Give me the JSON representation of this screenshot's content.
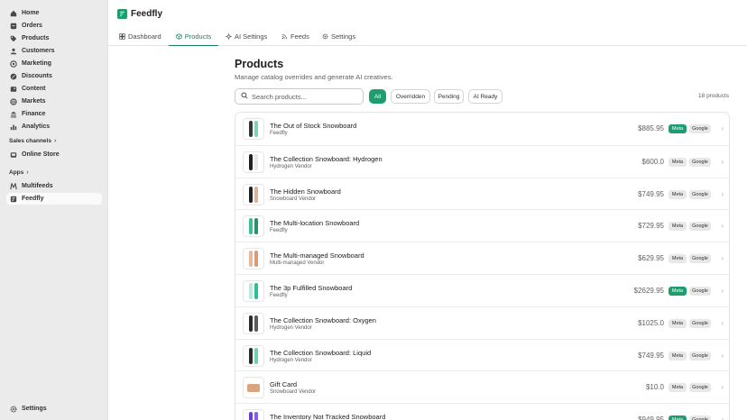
{
  "sidebar": {
    "items": [
      {
        "label": "Home",
        "icon": "home-icon"
      },
      {
        "label": "Orders",
        "icon": "orders-icon"
      },
      {
        "label": "Products",
        "icon": "tag-icon"
      },
      {
        "label": "Customers",
        "icon": "person-icon"
      },
      {
        "label": "Marketing",
        "icon": "target-icon"
      },
      {
        "label": "Discounts",
        "icon": "discount-icon"
      },
      {
        "label": "Content",
        "icon": "content-icon"
      },
      {
        "label": "Markets",
        "icon": "globe-icon"
      },
      {
        "label": "Finance",
        "icon": "bank-icon"
      },
      {
        "label": "Analytics",
        "icon": "chart-icon"
      }
    ],
    "sales_channels": "Sales channels",
    "online_store": "Online Store",
    "apps": "Apps",
    "app_items": [
      {
        "label": "Multifeeds",
        "icon": "multifeeds-icon"
      },
      {
        "label": "Feedfly",
        "icon": "feedfly-icon"
      }
    ],
    "settings": "Settings"
  },
  "header": {
    "app_title": "Feedfly"
  },
  "tabs": [
    {
      "label": "Dashboard",
      "icon": "grid-icon"
    },
    {
      "label": "Products",
      "icon": "box-icon"
    },
    {
      "label": "AI Settings",
      "icon": "sparkle-icon"
    },
    {
      "label": "Feeds",
      "icon": "rss-icon"
    },
    {
      "label": "Settings",
      "icon": "gear-icon"
    }
  ],
  "active_tab": "Products",
  "page": {
    "title": "Products",
    "subtitle": "Manage catalog overrides and generate AI creatives."
  },
  "search": {
    "placeholder": "Search products..."
  },
  "filters": [
    "All",
    "Overridden",
    "Pending",
    "AI Ready"
  ],
  "active_filter": "All",
  "count_label": "18 products",
  "badges": {
    "meta": "Meta",
    "google": "Google"
  },
  "products": [
    {
      "name": "The Out of Stock Snowboard",
      "vendor": "Feedfly",
      "price": "$885.95",
      "meta_on": true,
      "colors": [
        "#2f3a36",
        "#7fd1b9"
      ]
    },
    {
      "name": "The Collection Snowboard: Hydrogen",
      "vendor": "Hydrogen Vendor",
      "price": "$600.0",
      "meta_on": false,
      "colors": [
        "#1f1f1f",
        "#e8e8e8"
      ]
    },
    {
      "name": "The Hidden Snowboard",
      "vendor": "Snowboard Vendor",
      "price": "$749.95",
      "meta_on": false,
      "colors": [
        "#222222",
        "#d7b49a"
      ]
    },
    {
      "name": "The Multi-location Snowboard",
      "vendor": "Feedfly",
      "price": "$729.95",
      "meta_on": false,
      "colors": [
        "#3dbf95",
        "#2c8f6e"
      ]
    },
    {
      "name": "The Multi-managed Snowboard",
      "vendor": "Multi-managed Vendor",
      "price": "$629.95",
      "meta_on": false,
      "colors": [
        "#e9b79a",
        "#d49b7c"
      ]
    },
    {
      "name": "The 3p Fulfilled Snowboard",
      "vendor": "Feedfly",
      "price": "$2629.95",
      "meta_on": true,
      "colors": [
        "#bfe9dc",
        "#2fbf94"
      ]
    },
    {
      "name": "The Collection Snowboard: Oxygen",
      "vendor": "Hydrogen Vendor",
      "price": "$1025.0",
      "meta_on": false,
      "colors": [
        "#2a2a2a",
        "#5a5a5a"
      ]
    },
    {
      "name": "The Collection Snowboard: Liquid",
      "vendor": "Hydrogen Vendor",
      "price": "$749.95",
      "meta_on": false,
      "colors": [
        "#2b2b2b",
        "#6fd0b2"
      ]
    },
    {
      "name": "Gift Card",
      "vendor": "Snowboard Vendor",
      "price": "$10.0",
      "meta_on": false,
      "colors": [
        "#d9a57e",
        "#d9a57e"
      ]
    },
    {
      "name": "The Inventory Not Tracked Snowboard",
      "vendor": "",
      "price": "$949.95",
      "meta_on": true,
      "colors": [
        "#6b3fd1",
        "#8a5cf0"
      ]
    }
  ],
  "colors": {
    "accent": "#1f9d6f",
    "sidebar_bg": "#ebebeb"
  }
}
